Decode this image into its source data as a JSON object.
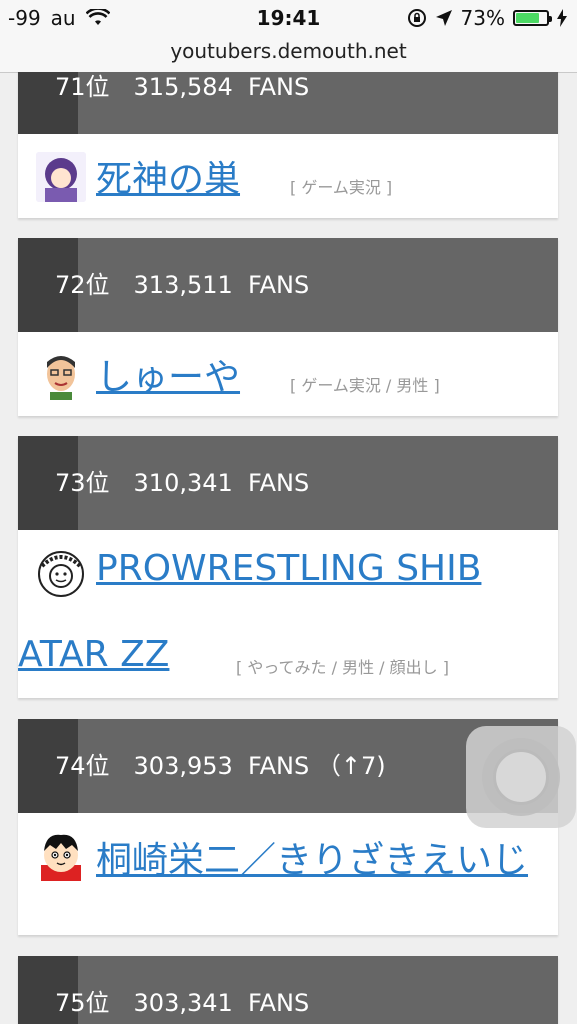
{
  "status": {
    "signal": "-99",
    "carrier": "au",
    "time": "19:41",
    "battery_pct": "73%"
  },
  "url": "youtubers.demouth.net",
  "entries": [
    {
      "rank": "71位　315,584  FANS",
      "name": "死神の巣",
      "category": "[ ゲーム実況 ]"
    },
    {
      "rank": "72位　313,511  FANS",
      "name": "しゅーや",
      "category": "[ ゲーム実況 / 男性 ]"
    },
    {
      "rank": "73位　310,341  FANS",
      "name_line1": "PROWRESTLING SHIB",
      "name_line2": "ATAR ZZ",
      "category": "[ やってみた / 男性 / 顔出し ]"
    },
    {
      "rank": "74位　303,953  FANS （↑7)",
      "name": "桐崎栄二／きりざきえいじ",
      "category": ""
    },
    {
      "rank": "75位　303,341  FANS"
    }
  ],
  "colors": {
    "link": "#2a7cc7",
    "header": "#666666",
    "tab": "#3f3f3f"
  }
}
